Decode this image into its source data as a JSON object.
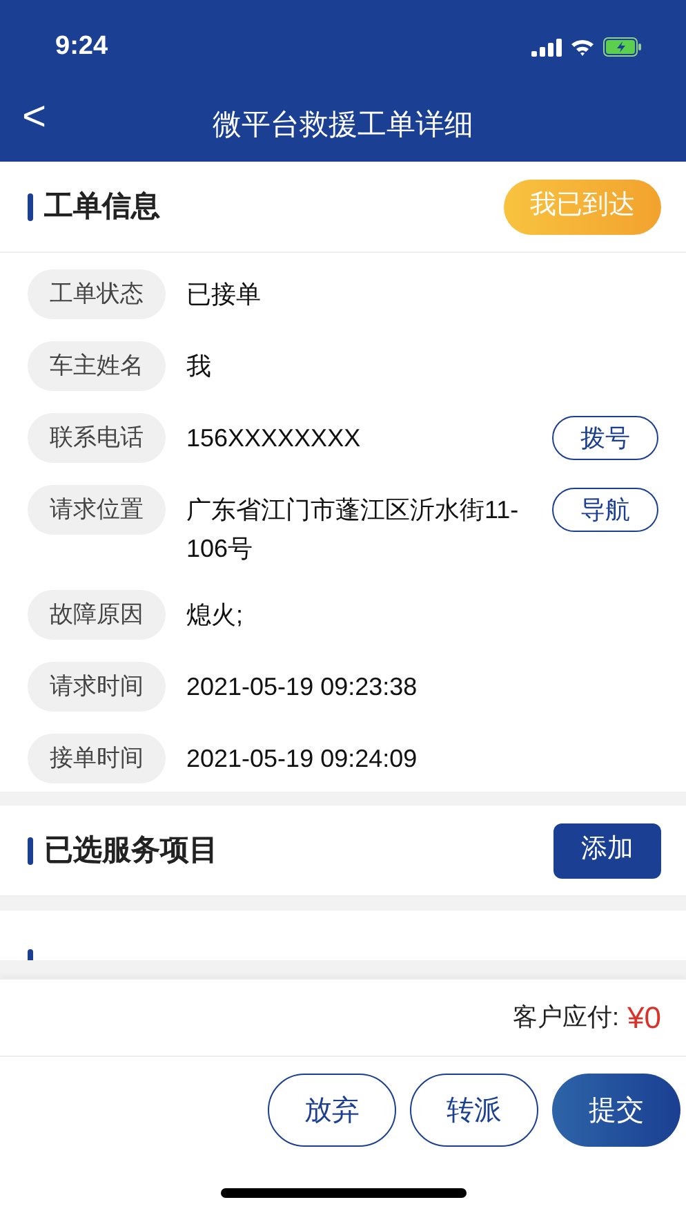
{
  "status_bar": {
    "time": "9:24"
  },
  "nav": {
    "back": "<",
    "title": "微平台救援工单详细"
  },
  "order_info": {
    "title": "工单信息",
    "status_button": "我已到达",
    "rows": [
      {
        "label": "工单状态",
        "value": "已接单"
      },
      {
        "label": "车主姓名",
        "value": "我"
      },
      {
        "label": "联系电话",
        "value": "156XXXXXXXX",
        "action": "拨号"
      },
      {
        "label": "请求位置",
        "value": "广东省江门市蓬江区沂水街11-106号",
        "action": "导航"
      },
      {
        "label": "故障原因",
        "value": "熄火;"
      },
      {
        "label": "请求时间",
        "value": "2021-05-19 09:23:38"
      },
      {
        "label": "接单时间",
        "value": "2021-05-19 09:24:09"
      }
    ]
  },
  "services": {
    "title": "已选服务项目",
    "add_button": "添加"
  },
  "footer": {
    "amount_label": "客户应付:",
    "amount": "¥0"
  },
  "buttons": [
    {
      "label": "放弃",
      "kind": "outline"
    },
    {
      "label": "转派",
      "kind": "outline"
    },
    {
      "label": "提交",
      "kind": "primary"
    }
  ]
}
